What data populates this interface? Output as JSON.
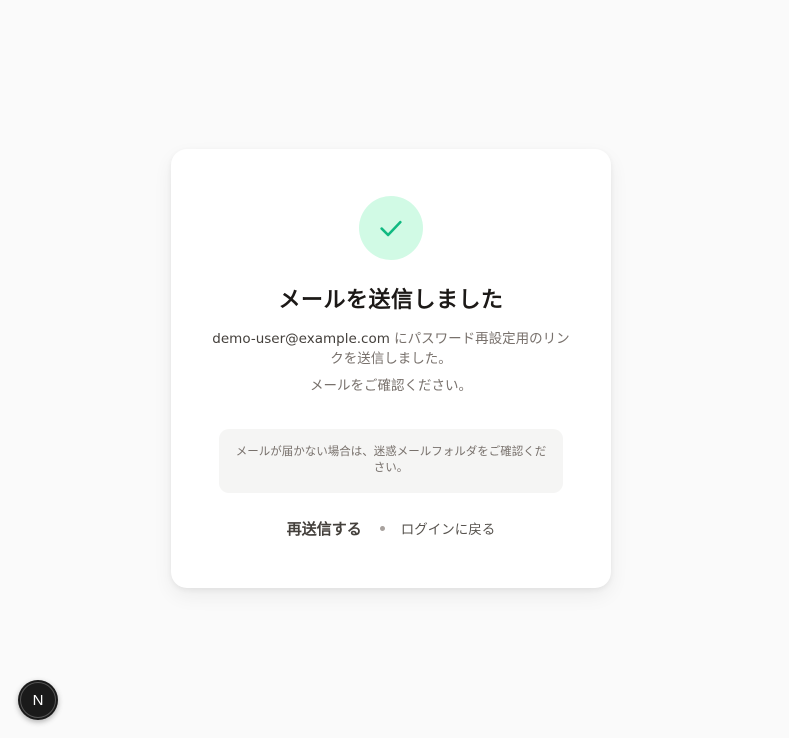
{
  "card": {
    "title": "メールを送信しました",
    "description_email": "demo-user@example.com",
    "description_rest": " にパスワード再設定用のリンクを送信しました。",
    "confirm_text": "メールをご確認ください。",
    "notice_text": "メールが届かない場合は、迷惑メールフォルダをご確認ください。",
    "resend_label": "再送信する",
    "back_to_login_label": "ログインに戻る"
  },
  "badge": {
    "letter": "N"
  },
  "colors": {
    "background": "#fafafa",
    "card": "#ffffff",
    "check_circle_bg": "#d1fae5",
    "check_color": "#10b981",
    "title": "#1c1917",
    "muted_text": "#78716c",
    "notice_bg": "#f5f5f4"
  },
  "icons": {
    "success": "check-icon",
    "badge": "nextjs-logo-icon"
  }
}
